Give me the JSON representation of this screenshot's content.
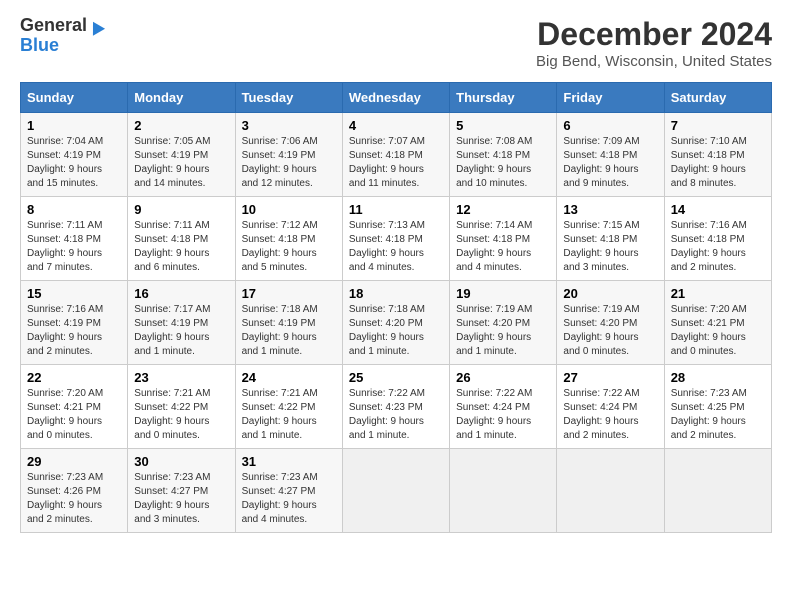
{
  "header": {
    "logo_general": "General",
    "logo_blue": "Blue",
    "month_title": "December 2024",
    "location": "Big Bend, Wisconsin, United States"
  },
  "days_of_week": [
    "Sunday",
    "Monday",
    "Tuesday",
    "Wednesday",
    "Thursday",
    "Friday",
    "Saturday"
  ],
  "weeks": [
    [
      {
        "day": "1",
        "sunrise": "7:04 AM",
        "sunset": "4:19 PM",
        "daylight": "9 hours and 15 minutes."
      },
      {
        "day": "2",
        "sunrise": "7:05 AM",
        "sunset": "4:19 PM",
        "daylight": "9 hours and 14 minutes."
      },
      {
        "day": "3",
        "sunrise": "7:06 AM",
        "sunset": "4:19 PM",
        "daylight": "9 hours and 12 minutes."
      },
      {
        "day": "4",
        "sunrise": "7:07 AM",
        "sunset": "4:18 PM",
        "daylight": "9 hours and 11 minutes."
      },
      {
        "day": "5",
        "sunrise": "7:08 AM",
        "sunset": "4:18 PM",
        "daylight": "9 hours and 10 minutes."
      },
      {
        "day": "6",
        "sunrise": "7:09 AM",
        "sunset": "4:18 PM",
        "daylight": "9 hours and 9 minutes."
      },
      {
        "day": "7",
        "sunrise": "7:10 AM",
        "sunset": "4:18 PM",
        "daylight": "9 hours and 8 minutes."
      }
    ],
    [
      {
        "day": "8",
        "sunrise": "7:11 AM",
        "sunset": "4:18 PM",
        "daylight": "9 hours and 7 minutes."
      },
      {
        "day": "9",
        "sunrise": "7:11 AM",
        "sunset": "4:18 PM",
        "daylight": "9 hours and 6 minutes."
      },
      {
        "day": "10",
        "sunrise": "7:12 AM",
        "sunset": "4:18 PM",
        "daylight": "9 hours and 5 minutes."
      },
      {
        "day": "11",
        "sunrise": "7:13 AM",
        "sunset": "4:18 PM",
        "daylight": "9 hours and 4 minutes."
      },
      {
        "day": "12",
        "sunrise": "7:14 AM",
        "sunset": "4:18 PM",
        "daylight": "9 hours and 4 minutes."
      },
      {
        "day": "13",
        "sunrise": "7:15 AM",
        "sunset": "4:18 PM",
        "daylight": "9 hours and 3 minutes."
      },
      {
        "day": "14",
        "sunrise": "7:16 AM",
        "sunset": "4:18 PM",
        "daylight": "9 hours and 2 minutes."
      }
    ],
    [
      {
        "day": "15",
        "sunrise": "7:16 AM",
        "sunset": "4:19 PM",
        "daylight": "9 hours and 2 minutes."
      },
      {
        "day": "16",
        "sunrise": "7:17 AM",
        "sunset": "4:19 PM",
        "daylight": "9 hours and 1 minute."
      },
      {
        "day": "17",
        "sunrise": "7:18 AM",
        "sunset": "4:19 PM",
        "daylight": "9 hours and 1 minute."
      },
      {
        "day": "18",
        "sunrise": "7:18 AM",
        "sunset": "4:20 PM",
        "daylight": "9 hours and 1 minute."
      },
      {
        "day": "19",
        "sunrise": "7:19 AM",
        "sunset": "4:20 PM",
        "daylight": "9 hours and 1 minute."
      },
      {
        "day": "20",
        "sunrise": "7:19 AM",
        "sunset": "4:20 PM",
        "daylight": "9 hours and 0 minutes."
      },
      {
        "day": "21",
        "sunrise": "7:20 AM",
        "sunset": "4:21 PM",
        "daylight": "9 hours and 0 minutes."
      }
    ],
    [
      {
        "day": "22",
        "sunrise": "7:20 AM",
        "sunset": "4:21 PM",
        "daylight": "9 hours and 0 minutes."
      },
      {
        "day": "23",
        "sunrise": "7:21 AM",
        "sunset": "4:22 PM",
        "daylight": "9 hours and 0 minutes."
      },
      {
        "day": "24",
        "sunrise": "7:21 AM",
        "sunset": "4:22 PM",
        "daylight": "9 hours and 1 minute."
      },
      {
        "day": "25",
        "sunrise": "7:22 AM",
        "sunset": "4:23 PM",
        "daylight": "9 hours and 1 minute."
      },
      {
        "day": "26",
        "sunrise": "7:22 AM",
        "sunset": "4:24 PM",
        "daylight": "9 hours and 1 minute."
      },
      {
        "day": "27",
        "sunrise": "7:22 AM",
        "sunset": "4:24 PM",
        "daylight": "9 hours and 2 minutes."
      },
      {
        "day": "28",
        "sunrise": "7:23 AM",
        "sunset": "4:25 PM",
        "daylight": "9 hours and 2 minutes."
      }
    ],
    [
      {
        "day": "29",
        "sunrise": "7:23 AM",
        "sunset": "4:26 PM",
        "daylight": "9 hours and 2 minutes."
      },
      {
        "day": "30",
        "sunrise": "7:23 AM",
        "sunset": "4:27 PM",
        "daylight": "9 hours and 3 minutes."
      },
      {
        "day": "31",
        "sunrise": "7:23 AM",
        "sunset": "4:27 PM",
        "daylight": "9 hours and 4 minutes."
      },
      null,
      null,
      null,
      null
    ]
  ]
}
